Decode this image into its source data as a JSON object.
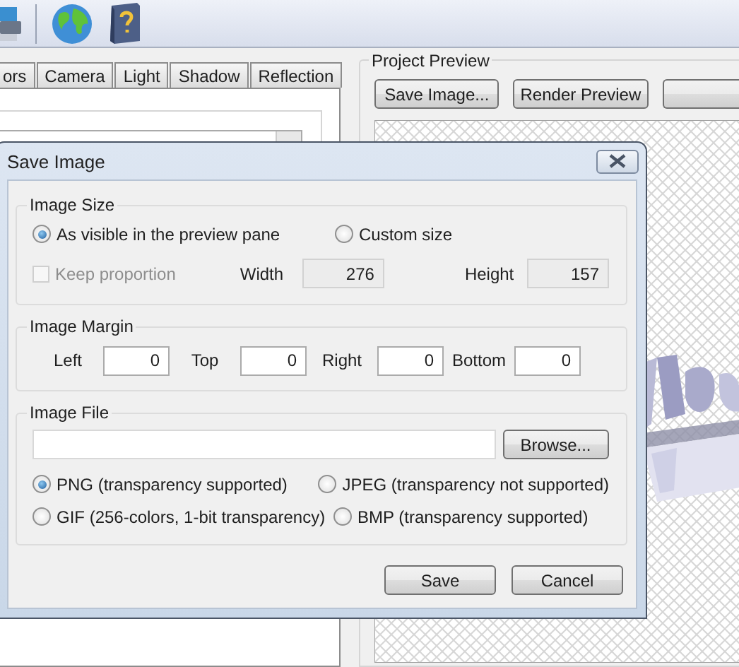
{
  "tabs": [
    {
      "label": "ors",
      "selected": false
    },
    {
      "label": "Camera",
      "selected": false
    },
    {
      "label": "Light",
      "selected": false
    },
    {
      "label": "Shadow",
      "selected": false
    },
    {
      "label": "Reflection",
      "selected": false
    }
  ],
  "preview": {
    "title": "Project Preview",
    "buttons": [
      "Save Image...",
      "Render Preview"
    ]
  },
  "dialog": {
    "title": "Save Image",
    "size_group": {
      "title": "Image Size",
      "options": [
        {
          "label": "As visible in the preview pane",
          "selected": true
        },
        {
          "label": "Custom size",
          "selected": false
        }
      ],
      "keep_proportion": {
        "label": "Keep proportion",
        "checked": false,
        "disabled": true
      },
      "fields": [
        {
          "label": "Width",
          "value": "276",
          "disabled": true
        },
        {
          "label": "Height",
          "value": "157",
          "disabled": true
        }
      ]
    },
    "margin_group": {
      "title": "Image Margin",
      "fields": [
        {
          "label": "Left",
          "value": "0"
        },
        {
          "label": "Top",
          "value": "0"
        },
        {
          "label": "Right",
          "value": "0"
        },
        {
          "label": "Bottom",
          "value": "0"
        }
      ]
    },
    "file_group": {
      "title": "Image File",
      "browse": "Browse...",
      "formats": [
        {
          "label": "PNG (transparency supported)",
          "selected": true
        },
        {
          "label": "JPEG (transparency not supported)",
          "selected": false
        },
        {
          "label": "GIF (256-colors, 1-bit transparency)",
          "selected": false
        },
        {
          "label": "BMP (transparency supported)",
          "selected": false
        }
      ]
    },
    "buttons": [
      "Save",
      "Cancel"
    ]
  }
}
